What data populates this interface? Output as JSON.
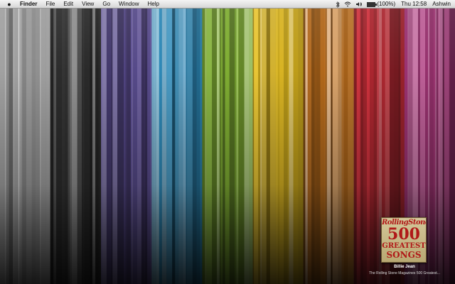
{
  "menubar": {
    "apple_icon": "apple-icon",
    "app_name": "Finder",
    "menus": [
      "File",
      "Edit",
      "View",
      "Go",
      "Window",
      "Help"
    ],
    "battery_label": "(100%)",
    "battery_level": 1.0,
    "clock": "Thu 12:58",
    "user": "Ashwin",
    "status_icons": [
      "bluetooth-icon",
      "wifi-icon",
      "volume-icon",
      "battery-icon"
    ]
  },
  "wallpaper": {
    "colors": [
      "#b8b8b8",
      "#3a3a3a",
      "#6a5aa8",
      "#2f8fc0",
      "#8fc23a",
      "#e8c020",
      "#d07a20",
      "#d0303a",
      "#b03a80"
    ]
  },
  "now_playing": {
    "art": {
      "magazine": "RollingStone",
      "number": "500",
      "line1": "GREATEST",
      "line2": "SONGS"
    },
    "title": "Billie Jean",
    "album": "The Rolling Stone Magazines 500 Greatest..."
  }
}
